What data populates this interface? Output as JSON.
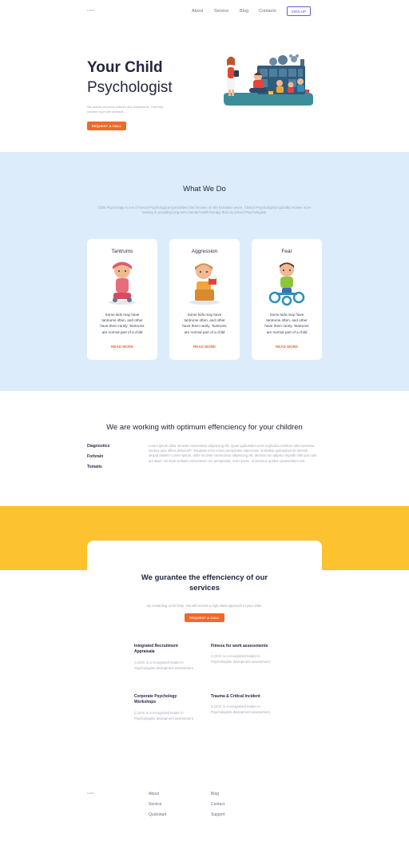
{
  "nav": {
    "logo": "LOGO",
    "links": [
      "About",
      "Service",
      "Blog",
      "Contacts"
    ],
    "signup": "SIGN UP"
  },
  "hero": {
    "title_line1": "Your Child",
    "title_line2": "Psychologist",
    "description": "We assess and treat children and adolescents. That help children cope with stresses.",
    "button": "REQUEST A CALL"
  },
  "what_we_do": {
    "title": "What We Do",
    "description": "Child Psychology is one of serval Psychological specialities that focuses on the formative years. Clinical Psychologists typically receive more training in providing long term mental health therapy than do school Psychologists.",
    "cards": [
      {
        "title": "Tantrums",
        "text": "Some kids may have tantrums often, and other have them rarely. Tantrums are normal part of a child",
        "link": "READ MORE"
      },
      {
        "title": "Aggression",
        "text": "Some kids may have tantrums often, and other have them rarely. Tantrums are normal part of a child",
        "link": "READ MORE"
      },
      {
        "title": "Fear",
        "text": "Some kids may have tantrums often, and other have them rarely. Tantrums are normal part of a child",
        "link": "READ MORE"
      }
    ]
  },
  "working": {
    "title": "We are working with optimum effenciency for your children",
    "items": [
      "Diagnostics",
      "Forbrain",
      "Tomatis"
    ],
    "text": "Lorem ipsum dolor sit amet consectetur adipisicing elit. Quae quibusdam enim explicabo nostrum odio inventore minima quia officia deserunt? Voluptate error minus perspiciatis aspernatur molestias quibusdam sit deleniti aliquid debitis? Lorem ipsum, dolor sit amet consectetur adipisicing elit. Minima non adipisci impedit nihil quo nam qui alias? Sit modi veritatis consectetur non perspiciatis, enim ipsam, id ducimus quidem praesentium nisi."
  },
  "guarantee": {
    "title": "We gurantee the effenciency of our services",
    "description": "By contacting us for help. You will receive a high-class approach to your child.",
    "button": "REQUEST A CALL",
    "services": [
      {
        "title": "Integrated Recrutiment Appraisala",
        "text": "C.DOC is a recognized leader in Psychologists devlopment assessment"
      },
      {
        "title": "Fitness for work assessments",
        "text": "C.DOC is a recognized leader in Psychologists devlopment assessment"
      },
      {
        "title": "Corporate Psychology Workshops",
        "text": "C.DOC is a recognized leader in Psychologists devlopment assessment"
      },
      {
        "title": "Trauma & Critical Incident",
        "text": "C.DOC is a recognized leader in Psychologists devlopment assessment"
      }
    ]
  },
  "footer": {
    "logo": "LOGO",
    "col1": [
      "About",
      "Service",
      "Quickstart"
    ],
    "col2": [
      "Blog",
      "Contact",
      "Support"
    ]
  },
  "colors": {
    "accent_orange": "#f2682a",
    "light_blue": "#dcecfb",
    "yellow": "#fcc22f",
    "signup_purple": "#5b4fc9"
  }
}
